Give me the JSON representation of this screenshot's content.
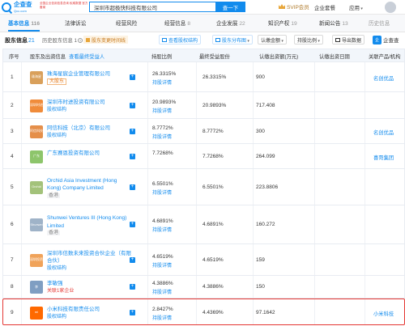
{
  "brand": {
    "name_line1": "企查查",
    "name_line2": "Qcc.com",
    "slogan": "全国企业信用信息查询 权威数据 官方备案"
  },
  "search": {
    "query": "深圳市超极快科技有限公司",
    "button": "查一下"
  },
  "topnav": {
    "svip": "SVIP会员",
    "enterprise": "企业套餐",
    "apps": "应用"
  },
  "tabs": [
    {
      "label": "基本信息",
      "count": "116"
    },
    {
      "label": "法律诉讼",
      "count": ""
    },
    {
      "label": "经营风险",
      "count": ""
    },
    {
      "label": "经营信息",
      "count": "8"
    },
    {
      "label": "企业发展",
      "count": "22"
    },
    {
      "label": "知识产权",
      "count": "19"
    },
    {
      "label": "新闻公告",
      "count": "13"
    },
    {
      "label": "历史信息",
      "count": ""
    }
  ],
  "section": {
    "title": "股东信息",
    "count": "21",
    "history": "历史股东信息",
    "history_count": "1",
    "notice": "股东变更时间线",
    "btn_structure": "查看股权结构",
    "btn_chart": "股东分布图",
    "btn_amount": "认缴金额",
    "btn_ratio": "持股比例",
    "btn_export": "导出数据",
    "badge_logo": "企",
    "badge": "企查查"
  },
  "table": {
    "headers": {
      "index": "序号",
      "shareholder": "股东及出资信息",
      "beneficiary_link": "查看最终受益人",
      "ratio": "持股比例",
      "final": "最终受益股份",
      "amount": "认缴出资额(万元)",
      "date": "认缴出资日期",
      "related": "关联产品/机构"
    },
    "rows": [
      {
        "index": "1",
        "logo": "珠海星",
        "logo_color": "#d9a05b",
        "name": "珠海星宸企业管理有限公司",
        "tag": "大股东",
        "tag_style": "orange",
        "ratio": "26.3315%",
        "chain": "持股详情",
        "final": "26.3315%",
        "amount": "900",
        "date": "",
        "related": "名创优品"
      },
      {
        "index": "2",
        "logo": "深圳时进",
        "logo_color": "#f08c3b",
        "name": "深圳市时进投资有限公司",
        "tag": "股权结构",
        "tag_style": "blue",
        "ratio": "20.9893%",
        "chain": "持股详情",
        "final": "20.9893%",
        "amount": "717.408",
        "date": "",
        "related": ""
      },
      {
        "index": "3",
        "logo": "阿信科技",
        "logo_color": "#e58f4a",
        "name": "阿信科技（北京）有限公司",
        "tag": "股权结构",
        "tag_style": "blue",
        "ratio": "8.7772%",
        "chain": "持股详情",
        "final": "8.7772%",
        "amount": "300",
        "date": "",
        "related": "名创优品"
      },
      {
        "index": "4",
        "logo": "广东",
        "logo_color": "#8dc56b",
        "name": "广东赛恩投资有限公司",
        "tag": "",
        "tag_style": "",
        "ratio": "7.7268%",
        "chain": "",
        "final": "7.7268%",
        "amount": "264.099",
        "date": "",
        "related": "喜哥集团"
      },
      {
        "index": "5",
        "logo": "Orchid",
        "logo_color": "#a3c27a",
        "name": "Orchid Asia Investment (Hong Kong) Company Limited",
        "tag": "香港",
        "tag_style": "gray",
        "ratio": "6.5501%",
        "chain": "持股详情",
        "final": "6.5501%",
        "amount": "223.8806",
        "date": "",
        "related": ""
      },
      {
        "index": "6",
        "logo": "Shunwei",
        "logo_color": "#9fb3c8",
        "name": "Shunwei Ventures III (Hong Kong) Limited",
        "tag": "香港",
        "tag_style": "gray",
        "ratio": "4.6891%",
        "chain": "持股详情",
        "final": "4.6891%",
        "amount": "160.272",
        "date": "",
        "related": ""
      },
      {
        "index": "7",
        "logo": "深圳投资",
        "logo_color": "#f0a35a",
        "name": "深圳市信数未来投资合伙企业（有限合伙）",
        "tag": "股权结构",
        "tag_style": "blue",
        "ratio": "4.6519%",
        "chain": "持股详情",
        "final": "4.6519%",
        "amount": "159",
        "date": "",
        "related": ""
      },
      {
        "index": "8",
        "logo": "李",
        "logo_color": "#7f9ec2",
        "name": "李敏强",
        "tag": "关联1家企业",
        "tag_style": "red",
        "ratio": "4.3886%",
        "chain": "持股详情",
        "final": "4.3886%",
        "amount": "150",
        "date": "",
        "related": ""
      },
      {
        "index": "9",
        "logo": "mi",
        "logo_color": "#ff6900",
        "name": "小米科技有限责任公司",
        "tag": "股权结构",
        "tag_style": "blue",
        "ratio": "2.8427%",
        "chain": "持股详情",
        "final": "4.4369%",
        "amount": "97.1642",
        "date": "",
        "related": "小米科技"
      }
    ]
  },
  "colors": {
    "accent": "#128bed",
    "highlight_border": "#e53935"
  }
}
